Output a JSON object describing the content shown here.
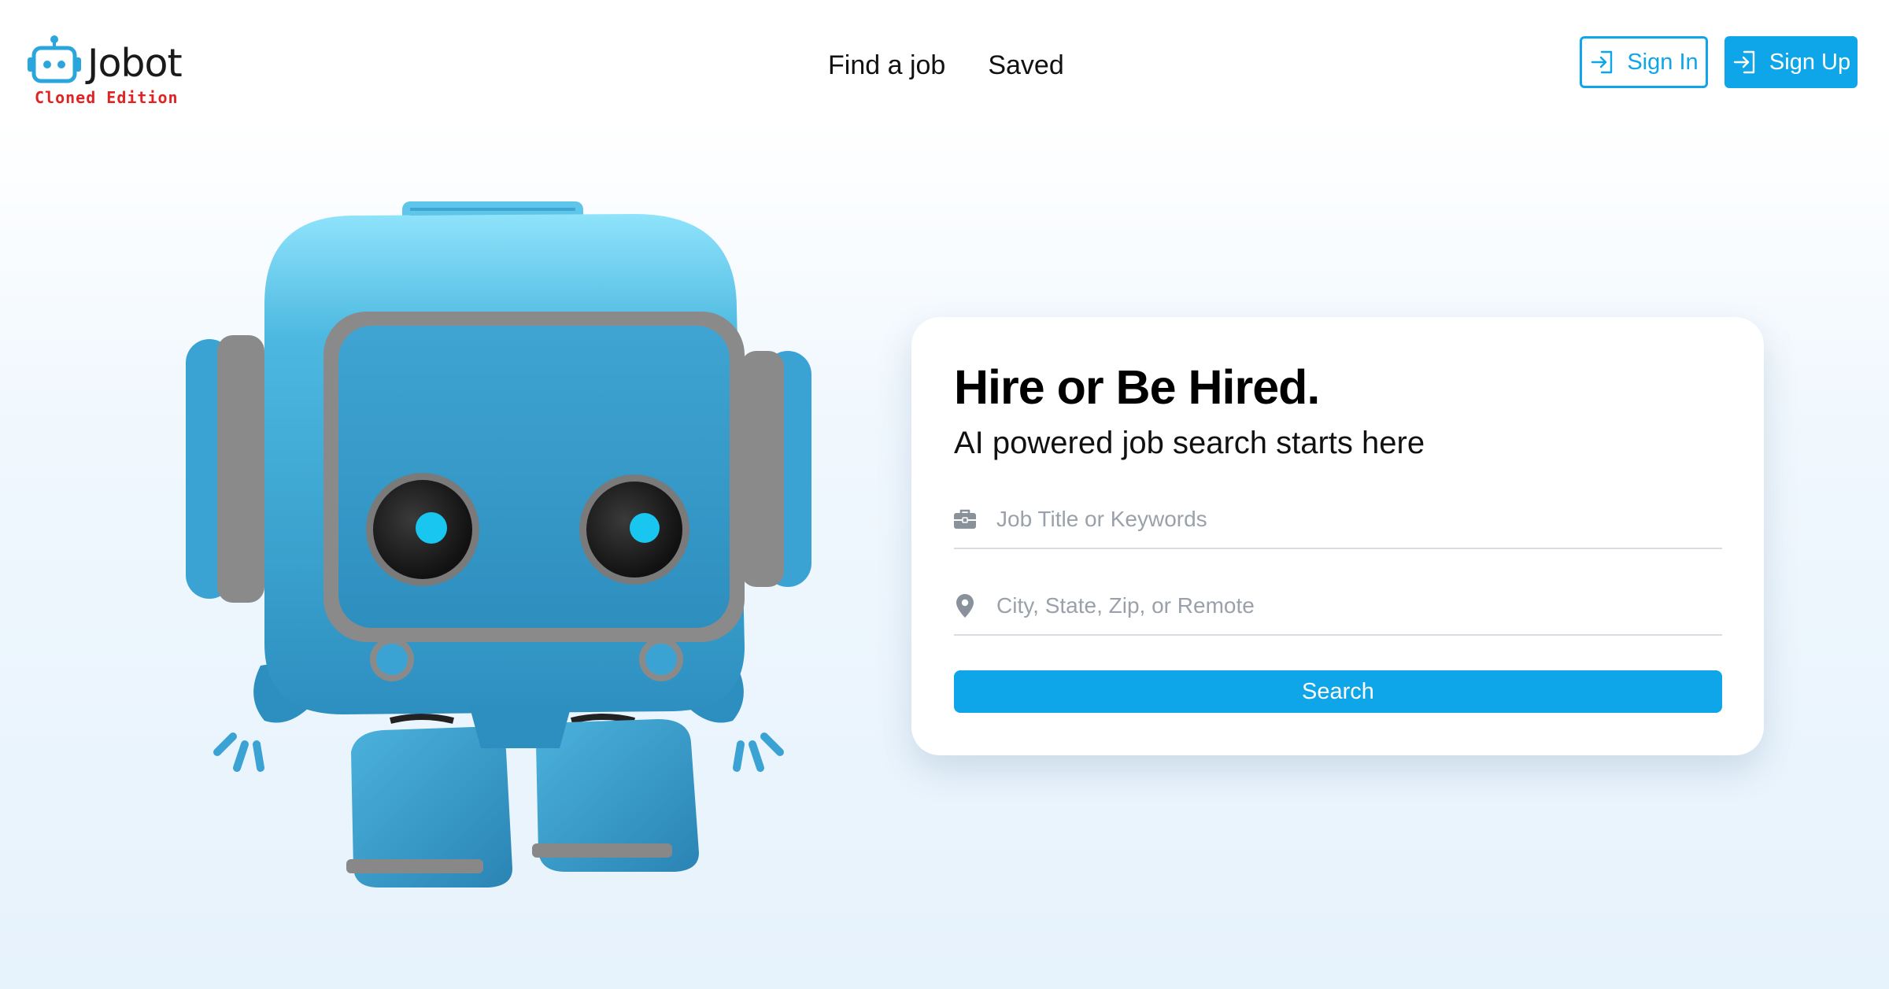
{
  "brand": {
    "name": "Jobot",
    "edition": "Cloned Edition"
  },
  "nav": {
    "items": [
      {
        "label": "Find a job"
      },
      {
        "label": "Saved"
      }
    ]
  },
  "auth": {
    "signin_label": "Sign In",
    "signup_label": "Sign Up"
  },
  "hero": {
    "title": "Hire or Be Hired.",
    "subtitle": "AI powered job search starts here",
    "keywords": {
      "placeholder": "Job Title or Keywords",
      "value": "",
      "icon": "briefcase-icon"
    },
    "location": {
      "placeholder": "City, State, Zip, or Remote",
      "value": "",
      "icon": "map-pin-icon"
    },
    "search_label": "Search"
  },
  "colors": {
    "accent": "#0ea5e9",
    "edition": "#e02424",
    "robot": "#3aa3d4"
  }
}
